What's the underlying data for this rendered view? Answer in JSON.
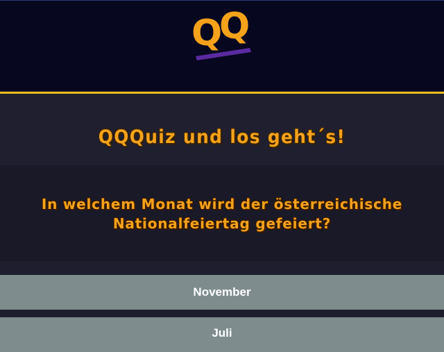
{
  "header": {
    "logo_text": "QQ",
    "colors": {
      "background": "#070720",
      "accent_line": "#f0c020",
      "logo_orange": "#f5a21b",
      "logo_underline": "#5a2aa0"
    }
  },
  "title": {
    "text": "QQQuiz und los geht´s!"
  },
  "question": {
    "text": "In welchem Monat wird der österreichische Nationalfeiertag gefeiert?"
  },
  "answers": [
    {
      "label": "November"
    },
    {
      "label": "Juli"
    }
  ],
  "colors": {
    "title_text": "#f5a21b",
    "answer_bg": "#7f8c8d",
    "answer_text": "#ffffff"
  }
}
